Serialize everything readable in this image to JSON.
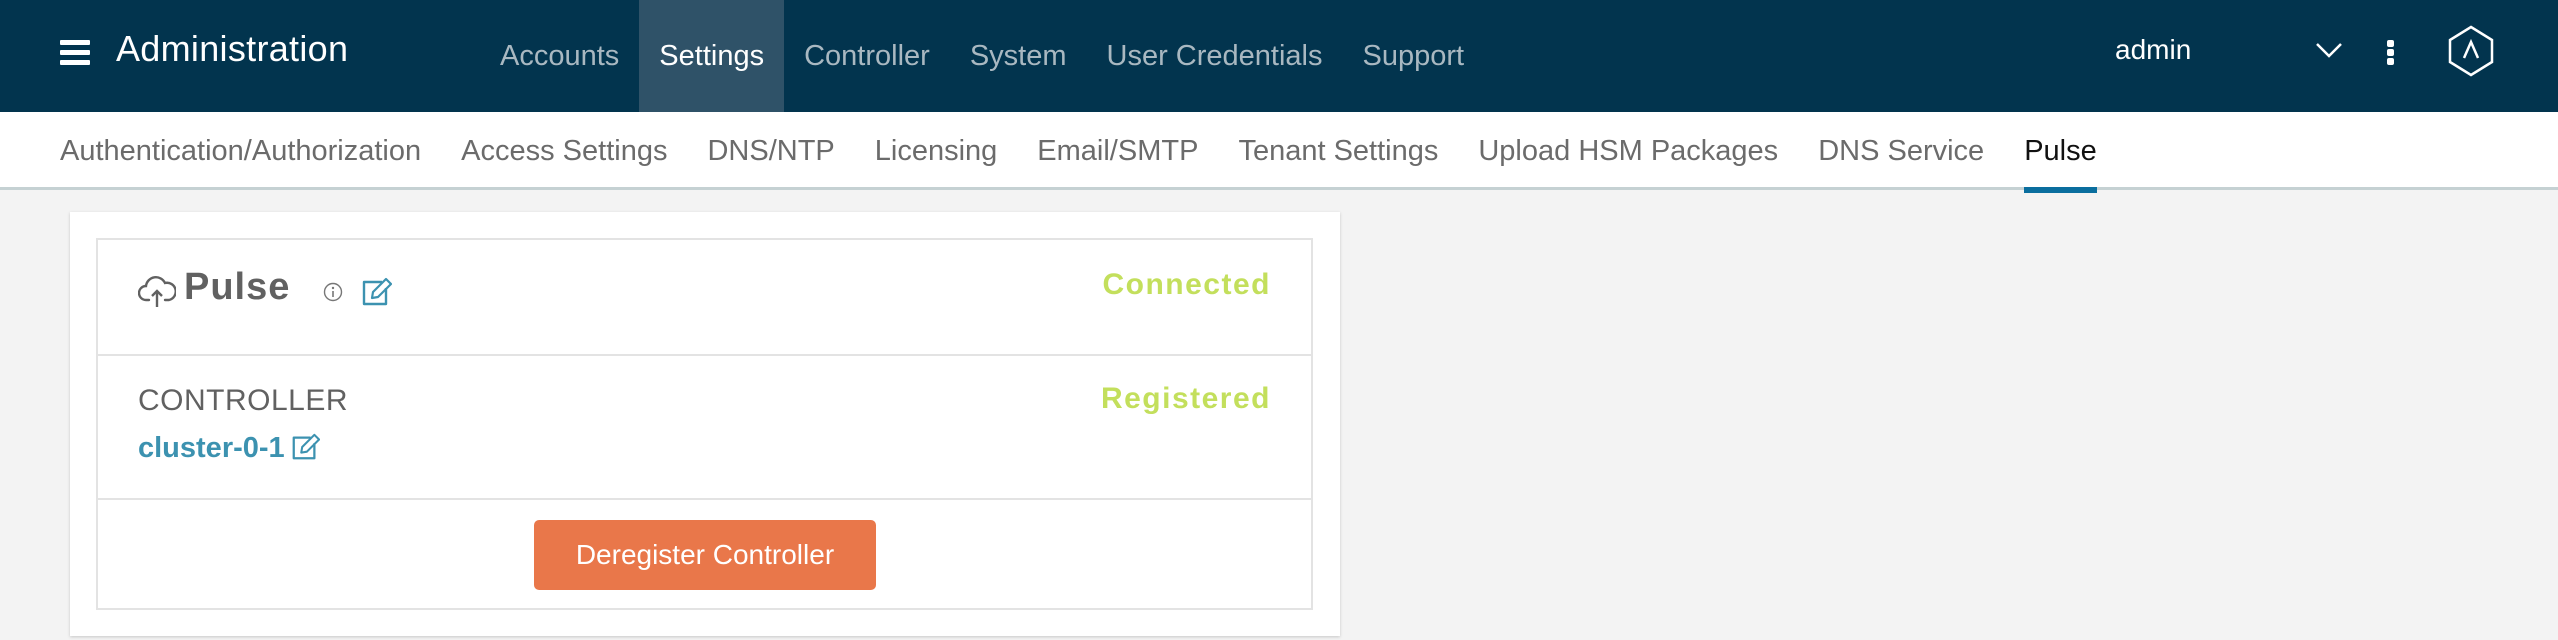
{
  "header": {
    "title": "Administration",
    "nav": [
      {
        "label": "Accounts",
        "active": false
      },
      {
        "label": "Settings",
        "active": true
      },
      {
        "label": "Controller",
        "active": false
      },
      {
        "label": "System",
        "active": false
      },
      {
        "label": "User Credentials",
        "active": false
      },
      {
        "label": "Support",
        "active": false
      }
    ],
    "user": "admin",
    "icons": {
      "menu": "hamburger-icon",
      "user_dropdown": "chevron-down-icon",
      "more": "kebab-icon",
      "logo": "hexagon-logo-icon"
    }
  },
  "subnav": {
    "tabs": [
      {
        "label": "Authentication/Authorization",
        "active": false
      },
      {
        "label": "Access Settings",
        "active": false
      },
      {
        "label": "DNS/NTP",
        "active": false
      },
      {
        "label": "Licensing",
        "active": false
      },
      {
        "label": "Email/SMTP",
        "active": false
      },
      {
        "label": "Tenant Settings",
        "active": false
      },
      {
        "label": "Upload HSM Packages",
        "active": false
      },
      {
        "label": "DNS Service",
        "active": false
      },
      {
        "label": "Pulse",
        "active": true
      }
    ]
  },
  "pulse": {
    "title": "Pulse",
    "status": "Connected",
    "controller_label": "CONTROLLER",
    "controller_name": "cluster-0-1",
    "registration_status": "Registered",
    "deregister_label": "Deregister Controller",
    "colors": {
      "status": "#c3df5c",
      "link": "#3c92b0",
      "danger_button": "#e9774a",
      "header_bg": "#02344e"
    }
  }
}
